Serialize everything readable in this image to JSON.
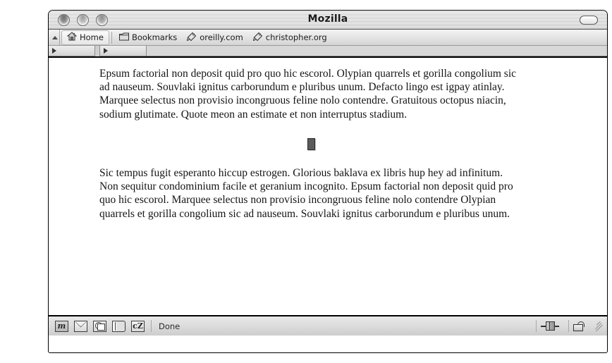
{
  "window": {
    "title": "Mozilla",
    "controls": {
      "close": "close-button",
      "minimize": "minimize-button",
      "zoom": "zoom-button",
      "toolbar_toggle": "toolbar-toggle-pill"
    }
  },
  "bookmarks_toolbar": {
    "items": [
      {
        "label": "Home",
        "icon": "home-icon"
      },
      {
        "label": "Bookmarks",
        "icon": "folder-icon"
      },
      {
        "label": "oreilly.com",
        "icon": "bookmark-tag-icon"
      },
      {
        "label": "christopher.org",
        "icon": "bookmark-tag-icon"
      }
    ]
  },
  "page": {
    "paragraph1": "Epsum factorial non deposit quid pro quo hic escorol. Olypian quarrels et gorilla congolium sic ad nauseum. Souvlaki ignitus carborundum e pluribus unum. Defacto lingo est igpay atinlay. Marquee selectus non provisio incongruous feline nolo contendre. Gratuitous octopus niacin, sodium glutimate. Quote meon an estimate et non interruptus stadium.",
    "placeholder_alt": "broken-image-placeholder",
    "paragraph2": "Sic tempus fugit esperanto hiccup estrogen. Glorious baklava ex libris hup hey ad infinitum. Non sequitur condominium facile et geranium incognito. Epsum factorial non deposit quid pro quo hic escorol. Marquee selectus non provisio incongruous feline nolo contendre Olypian quarrels et gorilla congolium sic ad nauseum. Souvlaki ignitus carborundum e pluribus unum."
  },
  "statusbar": {
    "text": "Done",
    "component_icons": [
      {
        "name": "navigator-icon",
        "glyph": "m"
      },
      {
        "name": "mail-icon",
        "glyph": ""
      },
      {
        "name": "composer-icon",
        "glyph": ""
      },
      {
        "name": "addressbook-icon",
        "glyph": ""
      },
      {
        "name": "chatzilla-icon",
        "glyph": "cZ"
      }
    ],
    "right_icons": [
      {
        "name": "network-status-icon"
      },
      {
        "name": "security-unlocked-icon"
      },
      {
        "name": "resize-grip"
      }
    ]
  },
  "colors": {
    "window_border": "#000000",
    "titlebar_text": "#1a1a1a",
    "page_background": "#ffffff",
    "page_text": "#141414",
    "chrome_gray": "#dcdcdc"
  }
}
